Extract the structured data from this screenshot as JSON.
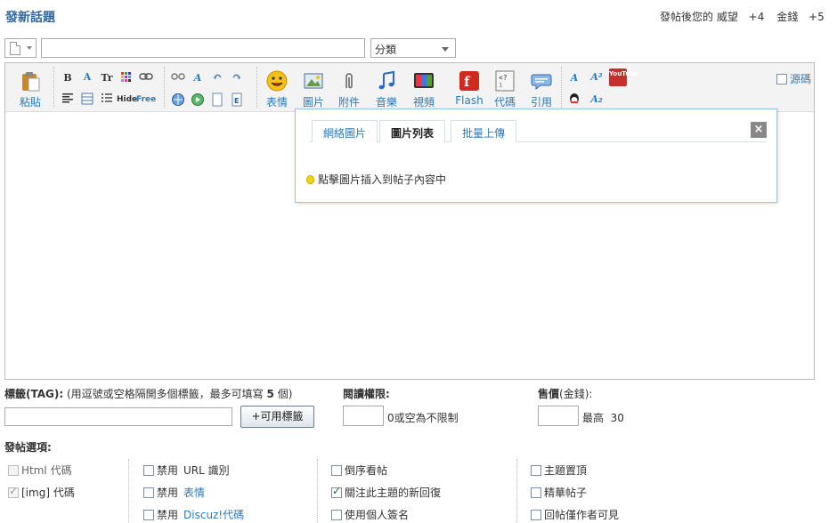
{
  "header": {
    "title": "發新話題",
    "reward_text": "發帖後您的 威望",
    "reward_prestige": "+4",
    "reward_money_label": "金錢",
    "reward_money": "+5"
  },
  "form": {
    "subject_value": "",
    "category": "分類"
  },
  "toolbar": {
    "paste": "粘貼",
    "smiley": "表情",
    "image": "圖片",
    "attachment": "附件",
    "music": "音樂",
    "video": "視頻",
    "flash": "Flash",
    "code": "代碼",
    "quote": "引用",
    "source": "源碼",
    "hide": "Hide",
    "free": "Free",
    "youtube": "YouTube"
  },
  "image_popup": {
    "tabs": [
      "網絡圖片",
      "圖片列表",
      "批量上傳"
    ],
    "active_tab": "圖片列表",
    "hint": "點擊圖片插入到帖子內容中"
  },
  "tags": {
    "label": "標籤(TAG):",
    "note": "(用逗號或空格隔開多個標籤，最多可填寫",
    "max": "5",
    "unit": "個)",
    "button": "+可用標籤"
  },
  "read_perm": {
    "label": "閱讀權限:",
    "hint": "0或空為不限制"
  },
  "price": {
    "label": "售價",
    "unit": "(金錢):",
    "max_label": "最高",
    "max": "30"
  },
  "options": {
    "label": "發帖選項:",
    "col1": [
      {
        "text": "Html 代碼",
        "checked": false,
        "disabled": true
      },
      {
        "text": "[img] 代碼",
        "checked": true,
        "disabled": true
      }
    ],
    "col2": [
      {
        "prefix": "禁用",
        "link": "URL 識別",
        "link_colored": false
      },
      {
        "prefix": "禁用",
        "link": "表情",
        "link_colored": true
      },
      {
        "prefix": "禁用",
        "link": "Discuz!代碼",
        "link_colored": true
      }
    ],
    "col3": [
      {
        "text": "倒序看帖",
        "checked": false
      },
      {
        "text": "關注此主題的新回復",
        "checked": true
      },
      {
        "text": "使用個人簽名",
        "checked": false
      }
    ],
    "col4": [
      {
        "text": "主題置頂",
        "checked": false
      },
      {
        "text": "精華帖子",
        "checked": false
      },
      {
        "text": "回帖僅作者可見",
        "checked": false
      }
    ]
  },
  "colors": {
    "link": "#2a7ab8",
    "title": "#336699",
    "popup_border": "#9ac8d8"
  }
}
